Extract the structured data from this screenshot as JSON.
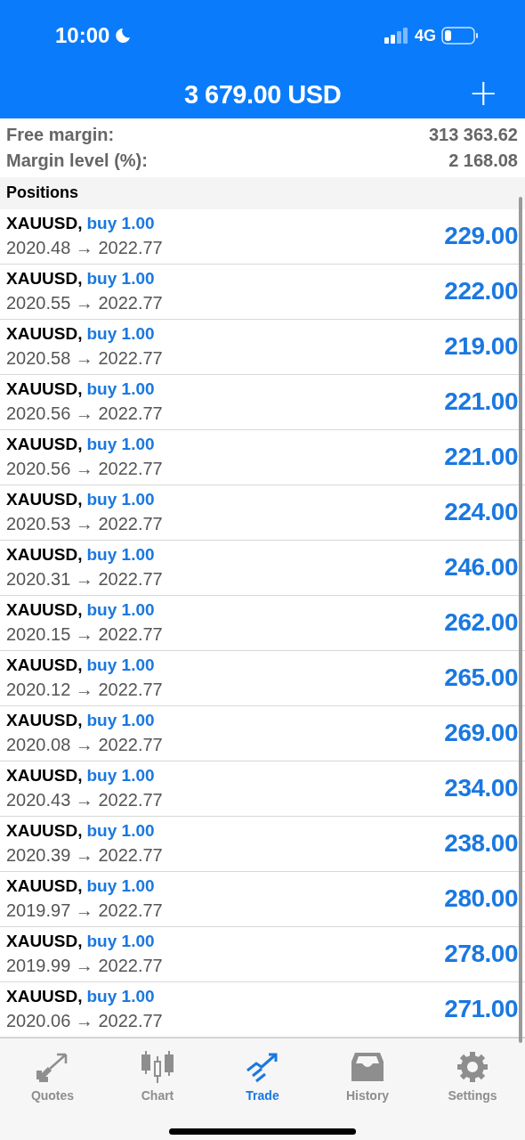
{
  "status_bar": {
    "time": "10:00",
    "network": "4G"
  },
  "header": {
    "title": "3 679.00 USD",
    "add_button": "+"
  },
  "summary": [
    {
      "label": "Free margin:",
      "value": "313 363.62"
    },
    {
      "label": "Margin level (%):",
      "value": "2 168.08"
    }
  ],
  "positions": {
    "title": "Positions",
    "rows": [
      {
        "symbol": "XAUUSD,",
        "order": "buy 1.00",
        "prices": "2020.48 → 2022.77",
        "profit": "229.00"
      },
      {
        "symbol": "XAUUSD,",
        "order": "buy 1.00",
        "prices": "2020.55 → 2022.77",
        "profit": "222.00"
      },
      {
        "symbol": "XAUUSD,",
        "order": "buy 1.00",
        "prices": "2020.58 → 2022.77",
        "profit": "219.00"
      },
      {
        "symbol": "XAUUSD,",
        "order": "buy 1.00",
        "prices": "2020.56 → 2022.77",
        "profit": "221.00"
      },
      {
        "symbol": "XAUUSD,",
        "order": "buy 1.00",
        "prices": "2020.56 → 2022.77",
        "profit": "221.00"
      },
      {
        "symbol": "XAUUSD,",
        "order": "buy 1.00",
        "prices": "2020.53 → 2022.77",
        "profit": "224.00"
      },
      {
        "symbol": "XAUUSD,",
        "order": "buy 1.00",
        "prices": "2020.31 → 2022.77",
        "profit": "246.00"
      },
      {
        "symbol": "XAUUSD,",
        "order": "buy 1.00",
        "prices": "2020.15 → 2022.77",
        "profit": "262.00"
      },
      {
        "symbol": "XAUUSD,",
        "order": "buy 1.00",
        "prices": "2020.12 → 2022.77",
        "profit": "265.00"
      },
      {
        "symbol": "XAUUSD,",
        "order": "buy 1.00",
        "prices": "2020.08 → 2022.77",
        "profit": "269.00"
      },
      {
        "symbol": "XAUUSD,",
        "order": "buy 1.00",
        "prices": "2020.43 → 2022.77",
        "profit": "234.00"
      },
      {
        "symbol": "XAUUSD,",
        "order": "buy 1.00",
        "prices": "2020.39 → 2022.77",
        "profit": "238.00"
      },
      {
        "symbol": "XAUUSD,",
        "order": "buy 1.00",
        "prices": "2019.97 → 2022.77",
        "profit": "280.00"
      },
      {
        "symbol": "XAUUSD,",
        "order": "buy 1.00",
        "prices": "2019.99 → 2022.77",
        "profit": "278.00"
      },
      {
        "symbol": "XAUUSD,",
        "order": "buy 1.00",
        "prices": "2020.06 → 2022.77",
        "profit": "271.00"
      }
    ]
  },
  "tabs": [
    {
      "kind": "quotes",
      "label": "Quotes",
      "selected": false
    },
    {
      "kind": "chart",
      "label": "Chart",
      "selected": false
    },
    {
      "kind": "trade",
      "label": "Trade",
      "selected": true
    },
    {
      "kind": "history",
      "label": "History",
      "selected": false
    },
    {
      "kind": "settings",
      "label": "Settings",
      "selected": false
    }
  ]
}
